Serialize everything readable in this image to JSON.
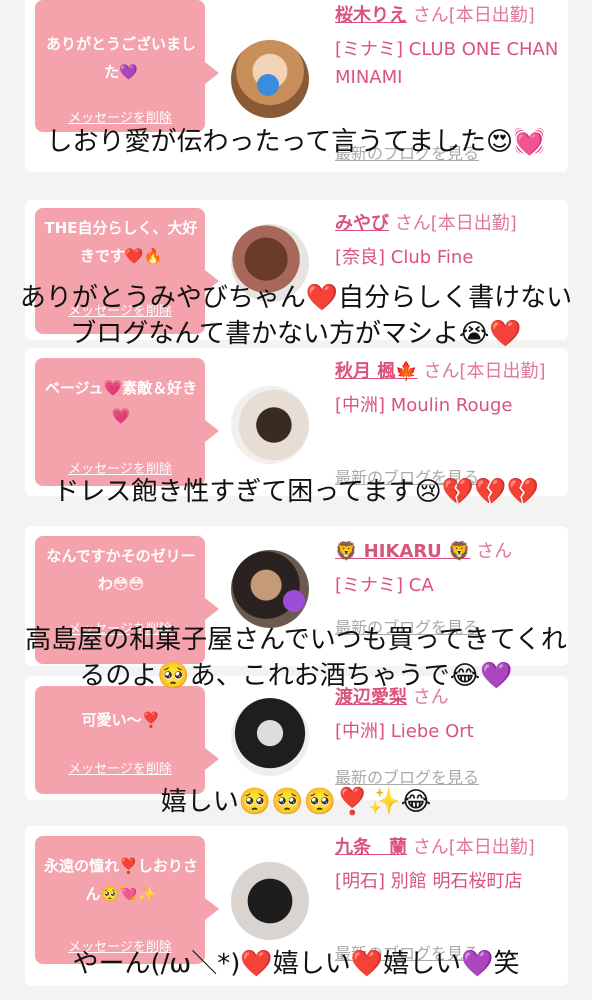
{
  "entries": [
    {
      "message": "ありがとうございました💜",
      "delete": "メッセージを削除",
      "name": "桜木りえ",
      "suffix": "さん[本日出勤]",
      "shop": "[ミナミ] CLUB ONE CHAN MINAMI",
      "blog": "最新のブログを見る",
      "caption": "しおり愛が伝わったって言うてました😍💓"
    },
    {
      "message": "THE自分らしく、大好きです❤️🔥",
      "delete": "メッセージを削除",
      "name": "みやび",
      "suffix": "さん[本日出勤]",
      "shop": "[奈良] Club Fine",
      "blog": "最新のブログを見る",
      "caption": "ありがとうみやびちゃん❤️自分らしく書けないブログなんて書かない方がマシよ😭❤️"
    },
    {
      "message": "ベージュ💗素敵＆好き💗",
      "delete": "メッセージを削除",
      "name": "秋月 楓🍁",
      "suffix": "さん[本日出勤]",
      "shop": "[中洲] Moulin Rouge",
      "blog": "最新のブログを見る",
      "caption": "ドレス飽き性すぎて困ってます😢💔💔💔"
    },
    {
      "message": "なんですかそのゼリーわ😳😳",
      "delete": "メッセージを削除",
      "name": "🦁 HIKARU 🦁",
      "suffix": "さん",
      "shop": "[ミナミ] CA",
      "blog": "最新のブログを見る",
      "caption": "高島屋の和菓子屋さんでいつも買ってきてくれるのよ🥺あ、これお酒ちゃうで😂💜"
    },
    {
      "message": "可愛い〜❣️",
      "delete": "メッセージを削除",
      "name": "渡辺愛梨",
      "suffix": "さん",
      "shop": "[中洲] Liebe Ort",
      "blog": "最新のブログを見る",
      "caption": "嬉しい🥺🥺🥺❣️✨😂"
    },
    {
      "message": "永遠の憧れ❣️しおりさん🥺💘✨",
      "delete": "メッセージを削除",
      "name": "九条　蘭",
      "suffix": "さん[本日出勤]",
      "shop": "[明石] 別館 明石桜町店",
      "blog": "最新のブログを見る",
      "caption": "やーん(/ω＼*)❤️嬉しい❤️嬉しい💜笑"
    }
  ],
  "colors": {
    "bubble": "#f4a2ac",
    "accent": "#d9537a",
    "background": "#f4f3f3"
  }
}
